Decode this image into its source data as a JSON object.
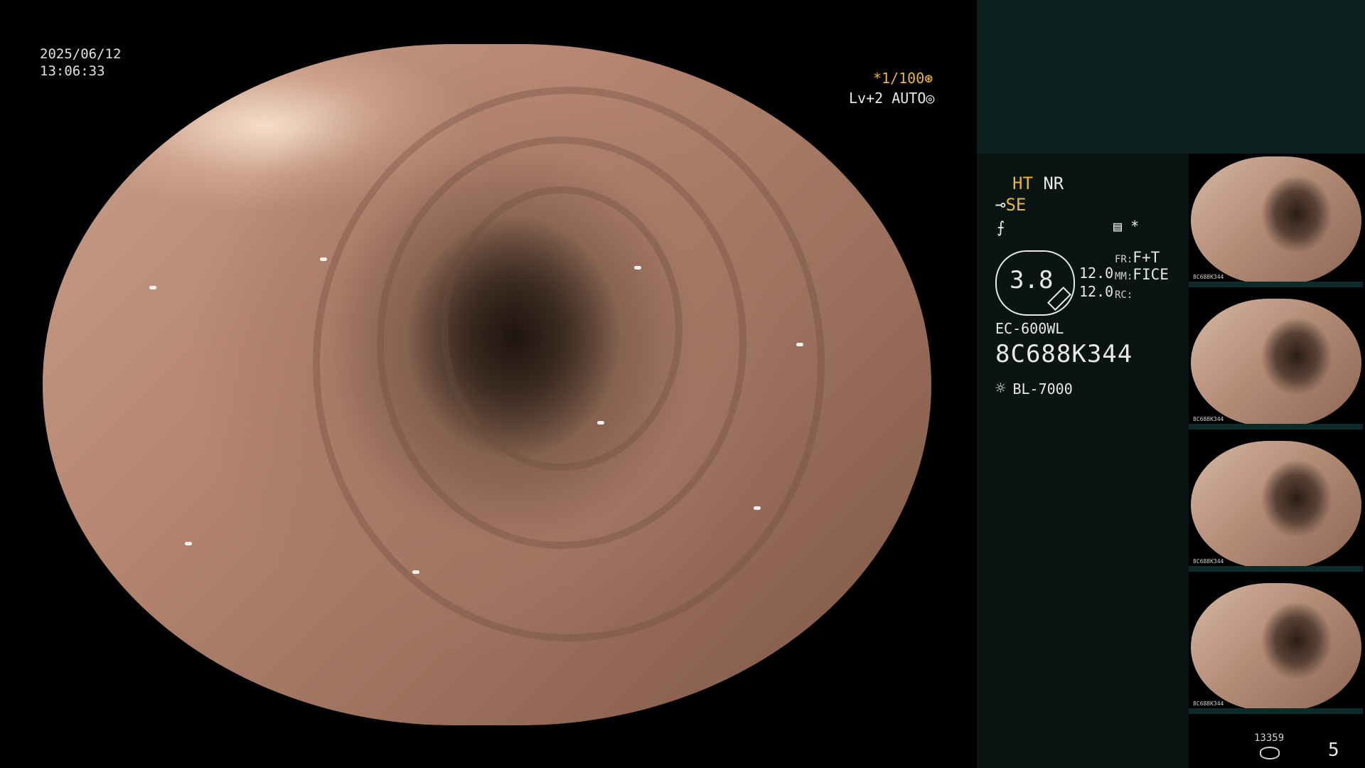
{
  "datetime": {
    "date": "2025/06/12",
    "time": "13:06:33"
  },
  "overlay": {
    "shutter": "*1/100",
    "shutter_icon": "aperture-icon",
    "level": "Lv+2 AUTO",
    "level_icon": "iris-icon"
  },
  "panel": {
    "ht": "HT",
    "nr": "NR",
    "se": "SE",
    "stat_icon": "menu-icon",
    "stat_star": "*",
    "magnification": "3.8",
    "values": [
      "12.0",
      "12.0"
    ],
    "fr_label": "FR:",
    "fr_value": "F+T",
    "mm_label": "MM:",
    "mm_value": "FICE",
    "rc_label": "RC:",
    "rc_value": "",
    "model": "EC-600WL",
    "serial": "8C688K344",
    "light_source": "BL-7000"
  },
  "thumbnails": [
    {
      "caption": "8C688K344"
    },
    {
      "caption": "8C688K344"
    },
    {
      "caption": "8C688K344"
    },
    {
      "caption": "8C688K344"
    }
  ],
  "footer": {
    "image_count": "13359",
    "page": "5"
  },
  "colors": {
    "accent_orange": "#e8b640",
    "panel_top": "#0b2220",
    "panel_side": "#0a1412"
  }
}
